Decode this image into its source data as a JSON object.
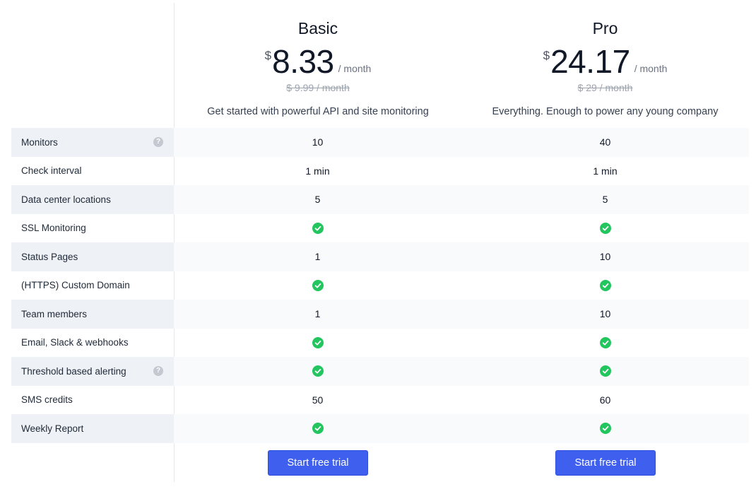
{
  "plans": {
    "basic": {
      "name": "Basic",
      "currency": "$",
      "price": "8.33",
      "period": "/ month",
      "old_price": "$ 9.99 / month",
      "description": "Get started with powerful API and site monitoring",
      "cta": "Start free trial"
    },
    "pro": {
      "name": "Pro",
      "currency": "$",
      "price": "24.17",
      "period": "/ month",
      "old_price": "$ 29 / month",
      "description": "Everything. Enough to power any young company",
      "cta": "Start free trial"
    }
  },
  "features": [
    {
      "label": "Monitors",
      "help": true,
      "basic": "10",
      "pro": "40"
    },
    {
      "label": "Check interval",
      "help": false,
      "basic": "1 min",
      "pro": "1 min"
    },
    {
      "label": "Data center locations",
      "help": false,
      "basic": "5",
      "pro": "5"
    },
    {
      "label": "SSL Monitoring",
      "help": false,
      "basic": "check-icon",
      "pro": "check-icon"
    },
    {
      "label": "Status Pages",
      "help": false,
      "basic": "1",
      "pro": "10"
    },
    {
      "label": "(HTTPS) Custom Domain",
      "help": false,
      "basic": "check-icon",
      "pro": "check-icon"
    },
    {
      "label": "Team members",
      "help": false,
      "basic": "1",
      "pro": "10"
    },
    {
      "label": "Email, Slack & webhooks",
      "help": false,
      "basic": "check-icon",
      "pro": "check-icon"
    },
    {
      "label": "Threshold based alerting",
      "help": true,
      "basic": "check-icon",
      "pro": "check-icon"
    },
    {
      "label": "SMS credits",
      "help": false,
      "basic": "50",
      "pro": "60"
    },
    {
      "label": "Weekly Report",
      "help": false,
      "basic": "check-icon",
      "pro": "check-icon"
    }
  ],
  "icons": {
    "help": "question-circle-icon",
    "check": "check-circle-icon"
  },
  "colors": {
    "check": "#22c55e",
    "cta": "#3f5fef",
    "feature_shade": "#eef1f6",
    "cell_shade": "#f8fafc"
  }
}
